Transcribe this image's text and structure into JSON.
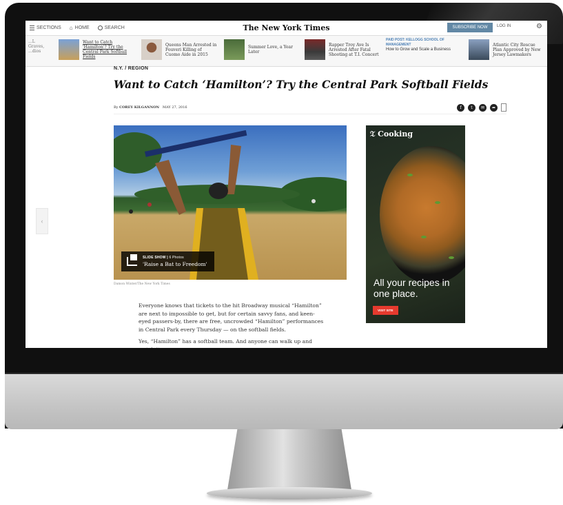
{
  "topbar": {
    "sections_label": "SECTIONS",
    "home_label": "HOME",
    "search_label": "SEARCH",
    "masthead": "The New York Times",
    "subscribe_label": "SUBSCRIBE NOW",
    "login_label": "LOG IN"
  },
  "ribbon": {
    "items": [
      {
        "text": "...L Graves, ...dios"
      },
      {
        "text": "Want to Catch 'Hamilton'? Try the Central Park Softball Fields"
      },
      {
        "text": "Queens Man Arrested in Fouveri Killing of Cuomo Aide in 2015"
      },
      {
        "text": "Summer Love, a Year Later"
      },
      {
        "text": "Rapper Troy Ave Is Arrested After Fatal Shooting at T.I. Concert"
      },
      {
        "label": "PAID POST: KELLOGG SCHOOL OF MANAGEMENT",
        "text": "How to Grow and Scale a Business"
      },
      {
        "text": "Atlantic City Rescue Plan Approved by New Jersey Lawmakers"
      }
    ]
  },
  "article": {
    "section": "N.Y. / REGION",
    "headline": "Want to Catch ‘Hamilton’? Try the Central Park Softball Fields",
    "byline_prefix": "By ",
    "author": "COREY KILGANNON",
    "date": "MAY 27, 2016",
    "slideshow": {
      "label": "SLIDE SHOW",
      "count": "6 Photos",
      "title": "'Raise a Bat to Freedom'"
    },
    "credit": "Damon Winter/The New York Times",
    "paragraphs": [
      "Everyone knows that tickets to the hit Broadway musical “Hamilton” are next to impossible to get, but for certain savvy fans, and keen-eyed passers-by, there are free, uncrowded “Hamilton” performances in Central Park every Thursday — on the softball fields.",
      "Yes, “Hamilton” has a softball team. And anyone can walk up and watch it"
    ]
  },
  "ad": {
    "brand": "Cooking",
    "tagline": "All your recipes in one place.",
    "button": "VISIT SITE"
  }
}
